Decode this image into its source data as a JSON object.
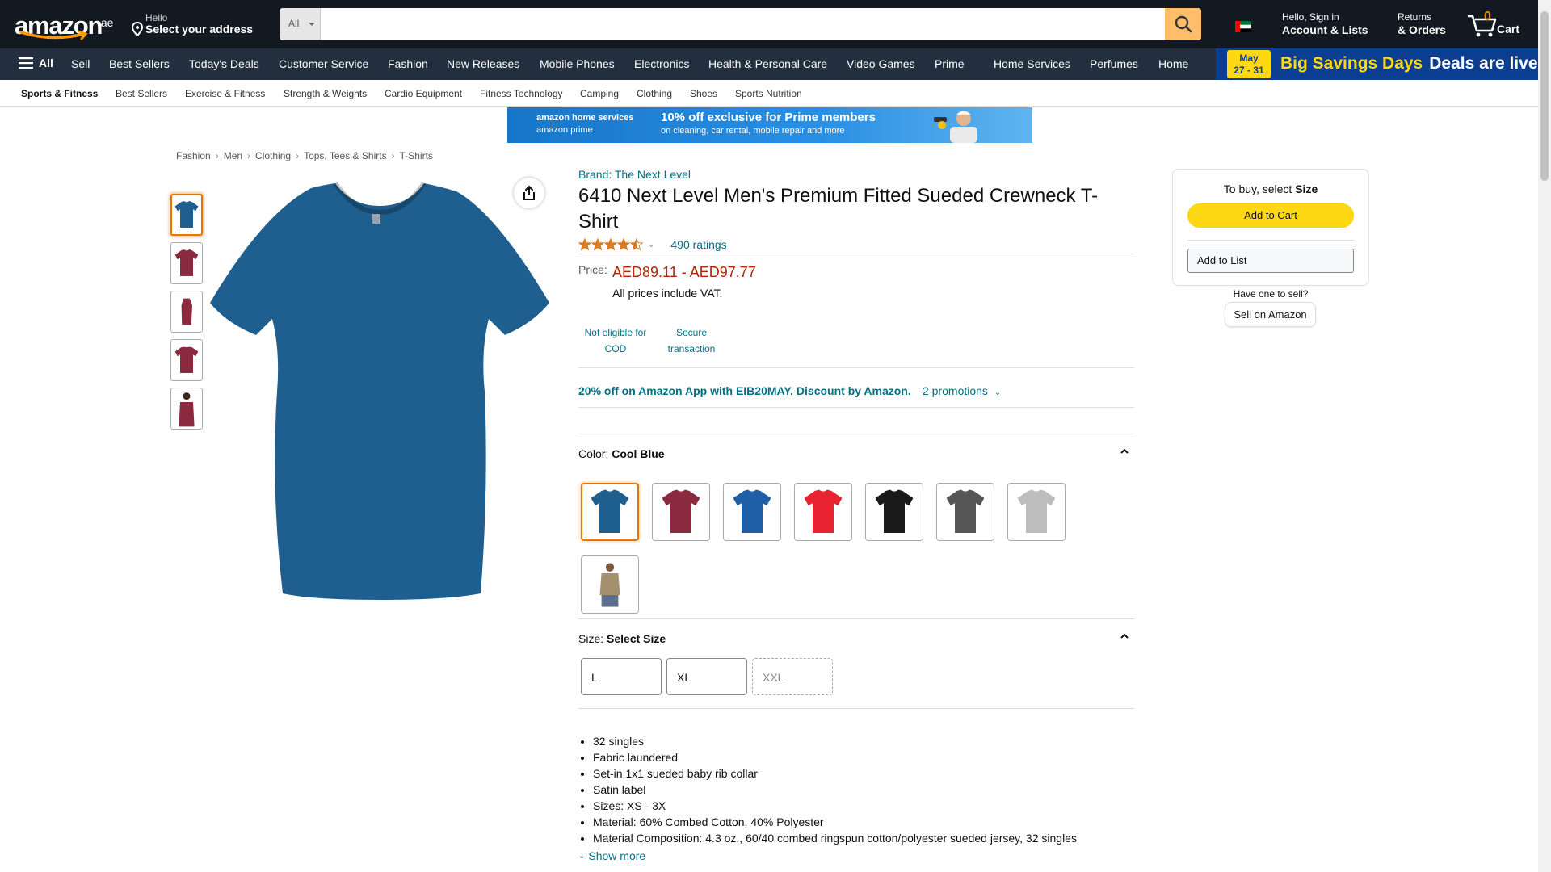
{
  "header": {
    "logo_text": "amazon",
    "logo_tld": ".ae",
    "address_line1": "Hello",
    "address_line2": "Select your address",
    "search_category": "All",
    "search_placeholder": "",
    "account_line1": "Hello, Sign in",
    "account_line2": "Account & Lists",
    "returns_line1": "Returns",
    "returns_line2": "& Orders",
    "cart_count": "0",
    "cart_label": "Cart",
    "accent_color": "#febd69"
  },
  "subnav": {
    "all_label": "All",
    "items": [
      "Sell",
      "Best Sellers",
      "Today's Deals",
      "Customer Service",
      "Fashion",
      "New Releases",
      "Mobile Phones",
      "Electronics",
      "Health & Personal Care",
      "Video Games",
      "Prime",
      "Home Services",
      "Perfumes",
      "Home"
    ],
    "promo_date_line1": "May",
    "promo_date_line2": "27 - 31",
    "promo_text1": "Big Savings Days",
    "promo_text2": "Deals are live"
  },
  "category_strip": [
    "Sports & Fitness",
    "Best Sellers",
    "Exercise & Fitness",
    "Strength & Weights",
    "Cardio Equipment",
    "Fitness Technology",
    "Camping",
    "Clothing",
    "Shoes",
    "Sports Nutrition"
  ],
  "ad": {
    "brand_line1": "amazon home services",
    "brand_line2": "amazon prime",
    "line1": "10% off exclusive for Prime members",
    "line2": "on cleaning, car rental, mobile repair and more"
  },
  "breadcrumb": [
    "Fashion",
    "Men",
    "Clothing",
    "Tops, Tees & Shirts",
    "T-Shirts"
  ],
  "product": {
    "brand": "Brand: The Next Level",
    "title": "6410 Next Level Men's Premium Fitted Sueded Crewneck T-Shirt",
    "rating_stars": 4.5,
    "ratings_count": "490 ratings",
    "price_label": "Price:",
    "price": "AED89.11 - AED97.77",
    "vat_note": "All prices include VAT.",
    "features": [
      {
        "line1": "Not eligible for",
        "line2": "COD"
      },
      {
        "line1": "Secure",
        "line2": "transaction"
      }
    ],
    "promo_text": "20% off on Amazon App with EIB20MAY. Discount by Amazon.",
    "promo_more": "2 promotions",
    "color_label": "Color:",
    "color_value": "Cool Blue",
    "colors": [
      "#1f5f8f",
      "#8b2a3f",
      "#1e5fa8",
      "#e8232f",
      "#1a1a1a",
      "#555555",
      "#bdbdbd",
      "#a48f6e"
    ],
    "size_label": "Size:",
    "size_value": "Select Size",
    "sizes": [
      {
        "label": "L",
        "available": true
      },
      {
        "label": "XL",
        "available": true
      },
      {
        "label": "XXL",
        "available": false
      }
    ],
    "bullets": [
      "32 singles",
      "Fabric laundered",
      "Set-in 1x1 sueded baby rib collar",
      "Satin label",
      "Sizes: XS - 3X",
      "Material: 60% Combed Cotton, 40% Polyester",
      "Material Composition: 4.3 oz., 60/40 combed ringspun cotton/polyester sueded jersey, 32 singles"
    ],
    "show_more": "Show more",
    "thumb_colors": [
      "#1f5f8f",
      "#8b2a3f",
      "#8b2a3f",
      "#8b2a3f",
      "#8b2a3f"
    ],
    "main_color": "#1f5f8f"
  },
  "buybox": {
    "to_buy_prefix": "To buy, select ",
    "to_buy_bold": "Size",
    "add_to_cart": "Add to Cart",
    "add_to_list": "Add to List",
    "sell_question": "Have one to sell?",
    "sell_button": "Sell on Amazon"
  }
}
